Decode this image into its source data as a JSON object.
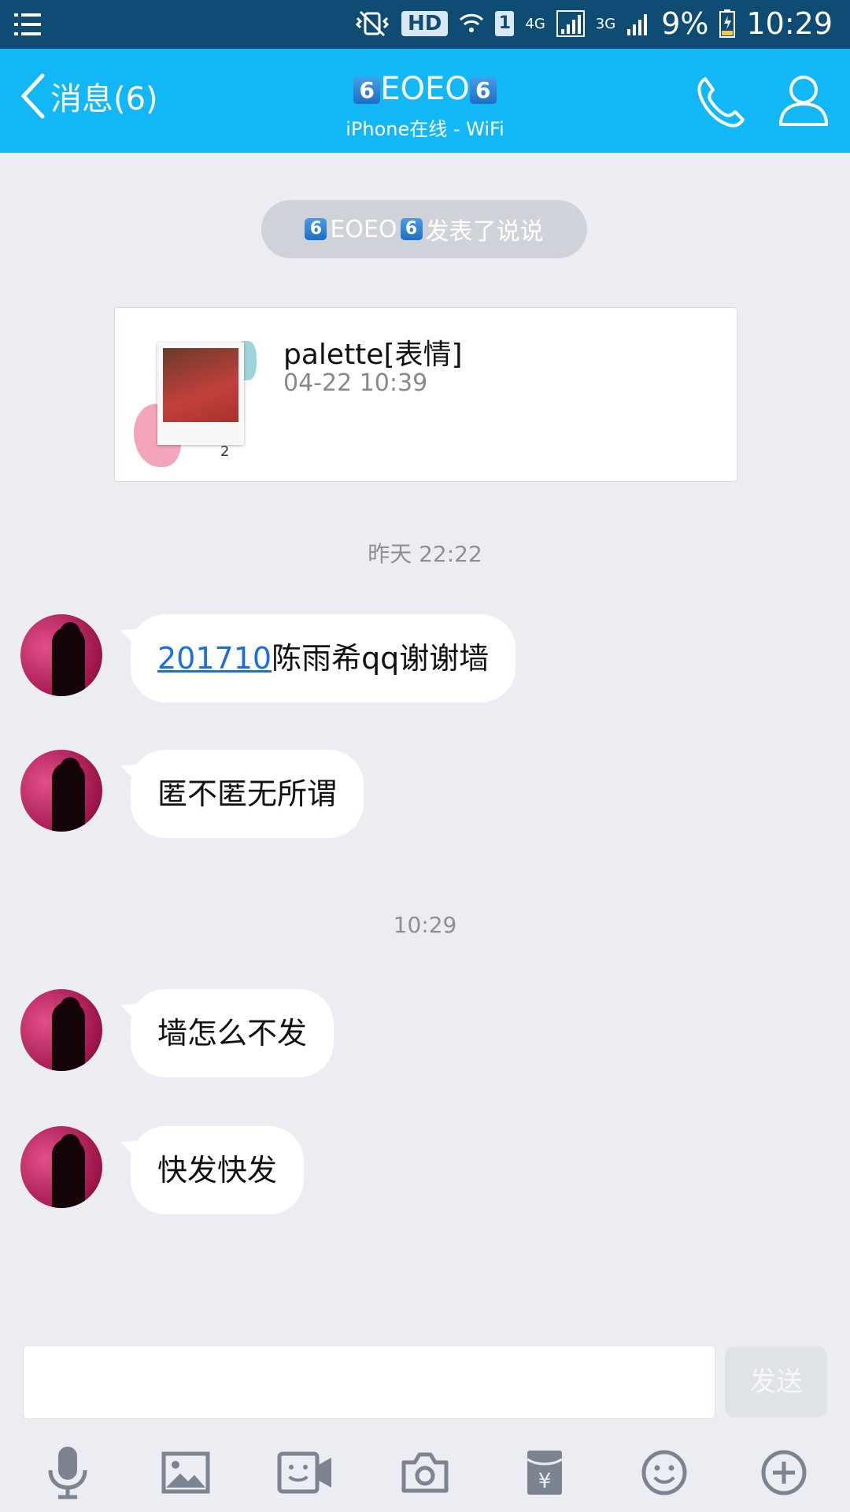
{
  "status_bar": {
    "hd_label": "HD",
    "sim_label": "1",
    "net_4g": "4G",
    "net_3g": "3G",
    "battery": "9%",
    "time": "10:29"
  },
  "header": {
    "back_label": "消息(6)",
    "contact_name": "EOEO",
    "emoji_badge": "6",
    "subtitle": "iPhone在线 - WiFi"
  },
  "notice": {
    "text": "EOEO",
    "suffix": "发表了说说"
  },
  "post": {
    "title": "palette[表情]",
    "time": "04-22 10:39",
    "image_count": "2"
  },
  "timestamps": [
    "昨天 22:22",
    "10:29"
  ],
  "messages": [
    {
      "link": "201710",
      "text": "陈雨希qq谢谢墙"
    },
    {
      "text": "匿不匿无所谓"
    },
    {
      "text": "墙怎么不发"
    },
    {
      "text": "快发快发"
    }
  ],
  "composer": {
    "send_label": "发送"
  },
  "colors": {
    "titlebar": "#12b7f5",
    "statusbar": "#0f4c74",
    "background": "#ebedf2",
    "link": "#1a6fe0"
  },
  "toolbar_icons": [
    "microphone-icon",
    "image-icon",
    "video-icon",
    "camera-icon",
    "red-packet-icon",
    "emoji-icon",
    "plus-icon"
  ]
}
